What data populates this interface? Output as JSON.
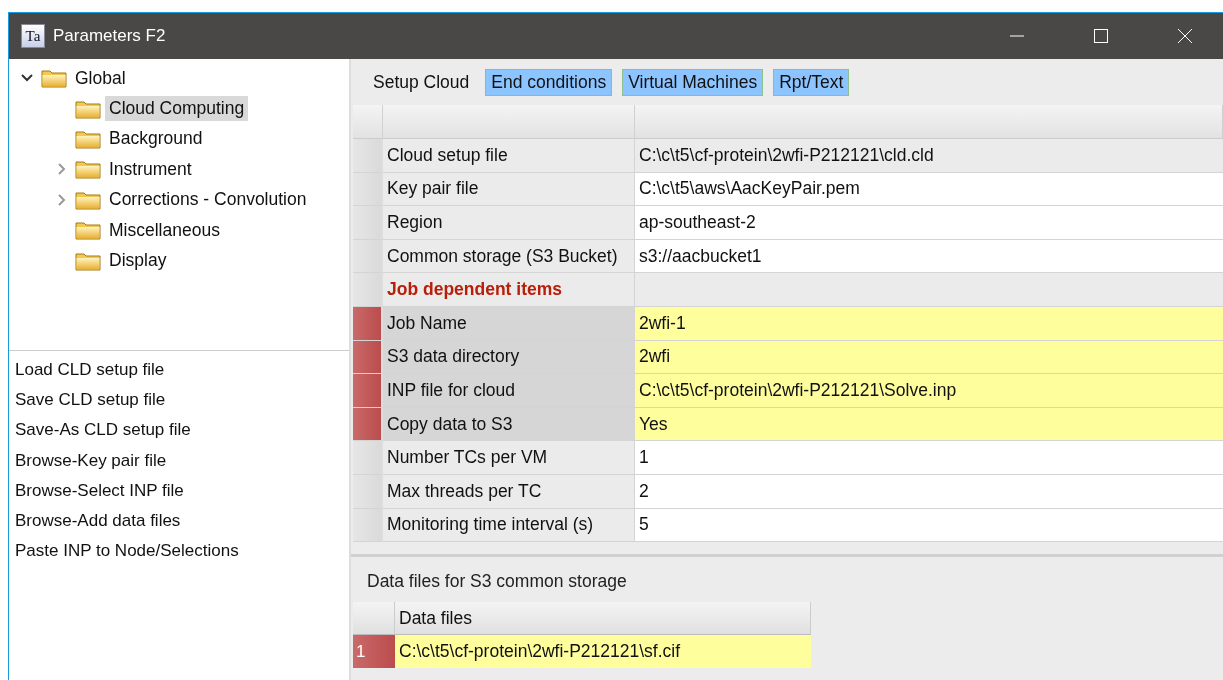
{
  "window": {
    "title": "Parameters F2",
    "icon_text": "Ta"
  },
  "tree": [
    {
      "label": "Global",
      "expanded": true,
      "selected": false,
      "children": [
        {
          "label": "Cloud Computing",
          "selected": true
        },
        {
          "label": "Background",
          "selected": false
        },
        {
          "label": "Instrument",
          "expanded": false,
          "selected": false
        },
        {
          "label": "Corrections - Convolution",
          "expanded": false,
          "selected": false
        },
        {
          "label": "Miscellaneous",
          "selected": false
        },
        {
          "label": "Display",
          "selected": false
        }
      ]
    }
  ],
  "commands": [
    "Load CLD setup file",
    "Save CLD setup file",
    "Save-As CLD setup file",
    "Browse-Key pair file",
    "Browse-Select INP file",
    "Browse-Add data files",
    "Paste INP to Node/Selections"
  ],
  "tabs": [
    {
      "label": "Setup Cloud",
      "selected": true
    },
    {
      "label": "End conditions",
      "selected": false
    },
    {
      "label": "Virtual Machines",
      "selected": false
    },
    {
      "label": "Rpt/Text",
      "selected": false
    }
  ],
  "grid": {
    "rows": [
      {
        "kind": "field",
        "label": "Cloud setup file",
        "value": "C:\\c\\t5\\cf-protein\\2wfi-P212121\\cld.cld",
        "required": false,
        "readonly": true
      },
      {
        "kind": "field",
        "label": "Key pair file",
        "value": "C:\\c\\t5\\aws\\AacKeyPair.pem",
        "required": false,
        "readonly": false
      },
      {
        "kind": "field",
        "label": "Region",
        "value": "ap-southeast-2",
        "required": false,
        "readonly": false
      },
      {
        "kind": "field",
        "label": "Common storage (S3 Bucket)",
        "value": "s3://aacbucket1",
        "required": false,
        "readonly": false
      },
      {
        "kind": "heading",
        "label": "Job dependent items"
      },
      {
        "kind": "field",
        "label": "Job Name",
        "value": "2wfi-1",
        "required": true,
        "readonly": false
      },
      {
        "kind": "field",
        "label": "S3 data directory",
        "value": "2wfi",
        "required": true,
        "readonly": false
      },
      {
        "kind": "field",
        "label": "INP file for cloud",
        "value": "C:\\c\\t5\\cf-protein\\2wfi-P212121\\Solve.inp",
        "required": true,
        "readonly": false
      },
      {
        "kind": "field",
        "label": "Copy data to S3",
        "value": "Yes",
        "required": true,
        "readonly": false
      },
      {
        "kind": "field",
        "label": "Number TCs per VM",
        "value": "1",
        "required": false,
        "readonly": false
      },
      {
        "kind": "field",
        "label": "Max threads per TC",
        "value": "2",
        "required": false,
        "readonly": false
      },
      {
        "kind": "field",
        "label": "Monitoring time interval (s)",
        "value": "5",
        "required": false,
        "readonly": false
      }
    ]
  },
  "data_files": {
    "title": "Data files for S3 common storage",
    "column": "Data files",
    "rows": [
      {
        "index": "1",
        "value": "C:\\c\\t5\\cf-protein\\2wfi-P212121\\sf.cif",
        "required": true
      }
    ]
  }
}
